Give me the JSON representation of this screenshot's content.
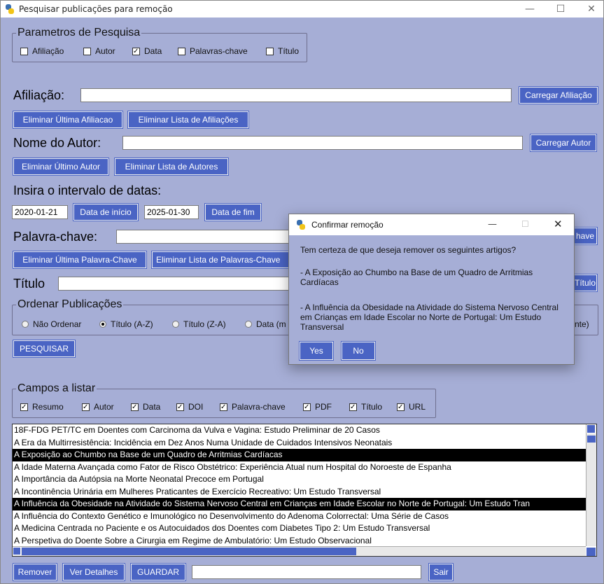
{
  "window": {
    "title": "Pesquisar publicações para remoção",
    "min": "—",
    "max": "☐",
    "close": "✕"
  },
  "params": {
    "legend": "Parametros de Pesquisa",
    "checkboxes": [
      {
        "label": "Afiliação",
        "checked": false
      },
      {
        "label": "Autor",
        "checked": false
      },
      {
        "label": "Data",
        "checked": true
      },
      {
        "label": "Palavras-chave",
        "checked": false
      },
      {
        "label": "Título",
        "checked": false
      }
    ]
  },
  "afiliacao": {
    "label": "Afiliação:",
    "value": "",
    "load": "Carregar Afiliação",
    "del_last": "Eliminar Última Afiliacao",
    "del_list": "Eliminar Lista de Afiliações"
  },
  "autor": {
    "label": "Nome do Autor:",
    "value": "",
    "load": "Carregar Autor",
    "del_last": "Eliminar Último Autor",
    "del_list": "Eliminar Lista de Autores"
  },
  "datas": {
    "label": "Insira o intervalo de datas:",
    "start": "2020-01-21",
    "start_btn": "Data de início",
    "end": "2025-01-30",
    "end_btn": "Data de fim"
  },
  "palavra": {
    "label": "Palavra-chave:",
    "value": "",
    "load_partial": "have",
    "del_last": "Eliminar Última Palavra-Chave",
    "del_list": "Eliminar Lista de Palavras-Chave"
  },
  "titulo": {
    "label": "Título",
    "value": "",
    "load_partial": "Título"
  },
  "ordenar": {
    "legend": "Ordenar Publicações",
    "options": [
      {
        "label": "Não Ordenar",
        "selected": false
      },
      {
        "label": "Título (A-Z)",
        "selected": true
      },
      {
        "label": "Título (Z-A)",
        "selected": false
      },
      {
        "label": "Data (m",
        "selected": false
      }
    ],
    "tail": "nte)"
  },
  "pesquisar": "PESQUISAR",
  "campos": {
    "legend": "Campos a listar",
    "checkboxes": [
      {
        "label": "Resumo",
        "checked": true
      },
      {
        "label": "Autor",
        "checked": true
      },
      {
        "label": "Data",
        "checked": true
      },
      {
        "label": "DOI",
        "checked": true
      },
      {
        "label": "Palavra-chave",
        "checked": true
      },
      {
        "label": "PDF",
        "checked": true
      },
      {
        "label": "Título",
        "checked": true
      },
      {
        "label": "URL",
        "checked": true
      }
    ]
  },
  "list": [
    {
      "text": "18F-FDG PET/TC em Doentes com Carcinoma da Vulva e Vagina: Estudo Preliminar de 20 Casos",
      "selected": false
    },
    {
      "text": "A Era da Multirresistência: Incidência em Dez Anos Numa Unidade de Cuidados Intensivos Neonatais",
      "selected": false
    },
    {
      "text": "A Exposição ao Chumbo na Base de um Quadro de Arritmias Cardíacas",
      "selected": true
    },
    {
      "text": "A Idade Materna Avançada como Fator de Risco Obstétrico: Experiência Atual num Hospital do Noroeste de Espanha",
      "selected": false
    },
    {
      "text": "A Importância da Autópsia na Morte Neonatal Precoce em Portugal",
      "selected": false
    },
    {
      "text": "A Incontinência Urinária em Mulheres Praticantes de Exercício Recreativo: Um Estudo Transversal",
      "selected": false
    },
    {
      "text": "A Influência da Obesidade na Atividade do Sistema Nervoso Central em Crianças em Idade Escolar no Norte de Portugal: Um Estudo Tran",
      "selected": true
    },
    {
      "text": "A Influência do Contexto Genético e Imunológico no Desenvolvimento do Adenoma Colorrectal: Uma Série de Casos",
      "selected": false
    },
    {
      "text": "A Medicina Centrada no Paciente e os Autocuidados dos Doentes com Diabetes Tipo 2: Um Estudo Transversal",
      "selected": false
    },
    {
      "text": "A Perspetiva do Doente Sobre a Cirurgia em Regime de Ambulatório: Um Estudo Observacional",
      "selected": false
    }
  ],
  "bottom": {
    "remover": "Remover",
    "detalhes": "Ver Detalhes",
    "guardar": "GUARDAR",
    "filename": "",
    "sair": "Sair"
  },
  "dialog": {
    "title": "Confirmar remoção",
    "question": "Tem certeza de que deseja remover os seguintes artigos?",
    "item1": "- A Exposição ao Chumbo na Base de um Quadro de Arritmias Cardíacas",
    "item2": "- A Influência da Obesidade na Atividade do Sistema Nervoso Central em Crianças em Idade Escolar no Norte de Portugal: Um Estudo Transversal",
    "yes": "Yes",
    "no": "No"
  },
  "colors": {
    "background": "#a6aed6",
    "button": "#4a64c4",
    "selection": "#000000"
  }
}
